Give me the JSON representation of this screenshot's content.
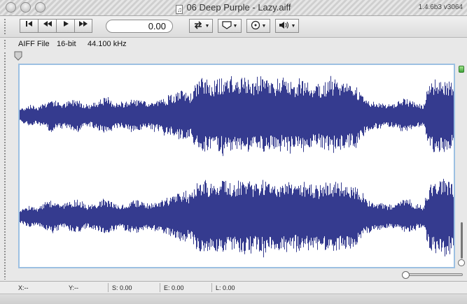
{
  "window": {
    "title": "06 Deep Purple - Lazy.aiff",
    "version": "1.4.6b3 v3064"
  },
  "icons": {
    "doc": "music-note-icon",
    "skip_start": "skip-to-start-icon",
    "rewind": "rewind-icon",
    "play": "play-icon",
    "fast_forward": "fast-forward-icon",
    "loop": "loop-icon",
    "marker": "marker-icon",
    "view": "view-icon",
    "volume": "volume-icon"
  },
  "toolbar": {
    "counter_value": "0.00"
  },
  "info": {
    "format": "AIFF File",
    "bit_depth": "16-bit",
    "sample_rate": "44.100 kHz"
  },
  "status": {
    "x": "X:--",
    "y": "Y:--",
    "s": "S: 0.00",
    "e": "E: 0.00",
    "l": "L: 0.00"
  },
  "colors": {
    "waveform": "#353b8f",
    "selection_border": "#9cc0e2",
    "marker_green": "#3fa338"
  },
  "waveform": {
    "channels": 2,
    "envelope": [
      0.18,
      0.2,
      0.28,
      0.25,
      0.22,
      0.3,
      0.34,
      0.42,
      0.38,
      0.33,
      0.3,
      0.36,
      0.4,
      0.44,
      0.35,
      0.3,
      0.28,
      0.33,
      0.4,
      0.45,
      0.42,
      0.38,
      0.33,
      0.3,
      0.35,
      0.38,
      0.42,
      0.4,
      0.36,
      0.33,
      0.35,
      0.38,
      0.4,
      0.45,
      0.48,
      0.5,
      0.6,
      0.62,
      0.58,
      0.55,
      0.78,
      0.9,
      0.92,
      0.88,
      0.85,
      0.9,
      0.93,
      0.94,
      0.9,
      0.88,
      0.92,
      0.95,
      0.9,
      0.88,
      0.85,
      0.9,
      0.92,
      0.88,
      0.86,
      0.84,
      0.88,
      0.9,
      0.85,
      0.82,
      0.86,
      0.88,
      0.84,
      0.8,
      0.78,
      0.82,
      0.86,
      0.88,
      0.9,
      0.86,
      0.82,
      0.8,
      0.78,
      0.7,
      0.55,
      0.45,
      0.38,
      0.32,
      0.35,
      0.3,
      0.28,
      0.3,
      0.34,
      0.4,
      0.42,
      0.38,
      0.34,
      0.3,
      0.28,
      0.7,
      0.9,
      0.93,
      0.95,
      0.92,
      0.88,
      0.8
    ]
  }
}
